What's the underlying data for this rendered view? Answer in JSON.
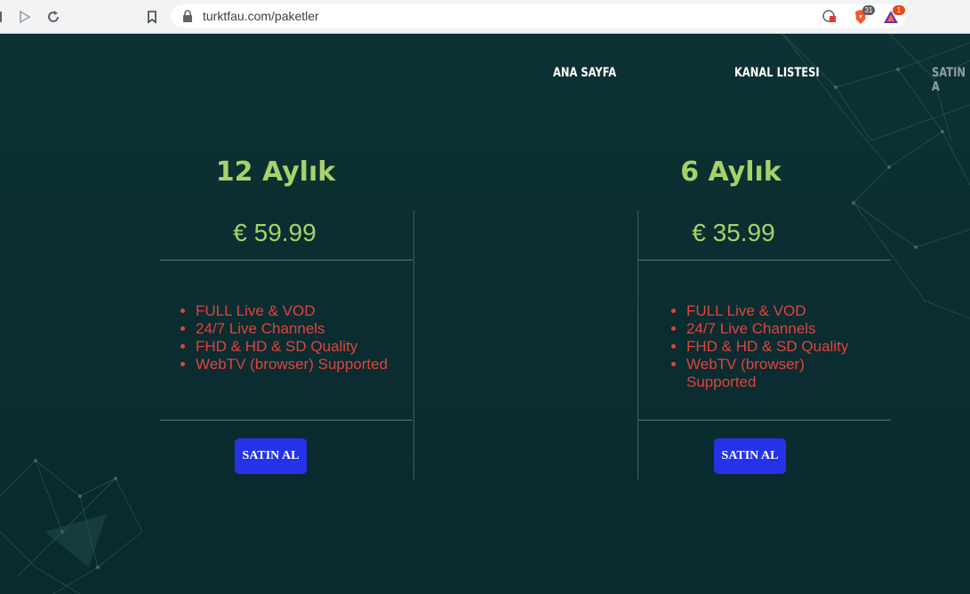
{
  "browser": {
    "url": "turktfau.com/paketler",
    "extensions": [
      {
        "name": "brave-shield-icon",
        "badge": "31",
        "badge_color": "#5a5a5a"
      },
      {
        "name": "brave-rewards-icon",
        "badge": "1",
        "badge_color": "#e64a19"
      }
    ]
  },
  "nav": {
    "items": [
      {
        "label": "ANA SAYFA"
      },
      {
        "label": "KANAL LISTESI"
      },
      {
        "label": "SATIN A"
      }
    ]
  },
  "packages": [
    {
      "title": "12 Aylık",
      "price": "€ 59.99",
      "features": [
        "FULL Live & VOD",
        "24/7 Live Channels",
        "FHD & HD & SD Quality",
        "WebTV (browser) Supported"
      ],
      "button_label": "SATIN AL"
    },
    {
      "title": "6 Aylık",
      "price": "€ 35.99",
      "features": [
        "FULL Live & VOD",
        "24/7 Live Channels",
        "FHD & HD & SD Quality",
        "WebTV (browser) Supported"
      ],
      "button_label": "SATIN AL"
    }
  ],
  "colors": {
    "background": "#0c2e31",
    "title": "#a8d269",
    "features": "#e0443c",
    "button": "#2533e8"
  }
}
